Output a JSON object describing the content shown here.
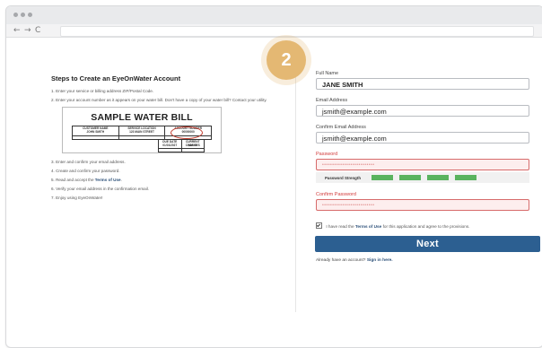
{
  "browser": {
    "nav": {
      "back": "←",
      "forward": "→",
      "reload": "C"
    }
  },
  "badge": {
    "number": "2"
  },
  "steps": {
    "title": "Steps to Create an EyeOnWater Account",
    "items": [
      "1. Enter your service or billing address ZIP/Postal Code.",
      "2. Enter your account number as it appears on your water bill. Don't have a copy of your water bill? Contact your utility.",
      "3. Enter and confirm your email address.",
      "4. Create and confirm your password.",
      "5. Read and accept the",
      "6. Verify your email address in the confirmation email.",
      "7. Enjoy using EyeOnWater!"
    ],
    "terms_link": "Terms of Use",
    "bill": {
      "title": "SAMPLE WATER BILL",
      "headers": [
        "CUSTOMER NAME",
        "SERVICE LOCATION",
        "ACCOUNT NUMBER"
      ],
      "values": [
        "JOHN SMITH",
        "123 MAIN STREET",
        "00000000"
      ],
      "headers2": [
        "DUE DATE",
        "CURRENT CHARGES"
      ],
      "values2": [
        "01/01/2027",
        "$00.00"
      ]
    }
  },
  "form": {
    "full_name_label": "Full Name",
    "full_name_value": "JANE SMITH",
    "email_label": "Email Address",
    "email_value": "jsmith@example.com",
    "confirm_email_label": "Confirm Email Address",
    "confirm_email_value": "jsmith@example.com",
    "password_label": "Password",
    "password_value": "••••••••••••••••••••••••••",
    "strength_label": "Password Strength",
    "strength_level": 4,
    "confirm_password_label": "Confirm Password",
    "confirm_password_value": "••••••••••••••••••••••••••",
    "terms_prefix": "I have read the",
    "terms_link": "Terms of Use",
    "terms_suffix": "for this application and agree to the provisions.",
    "next_label": "Next",
    "already_text": "Already have an account?",
    "sign_in_link": "Sign in here."
  },
  "colors": {
    "accent": "#2c5f91",
    "badge": "#e4b873",
    "error": "#d23a3a",
    "strength": "#59b35e"
  }
}
